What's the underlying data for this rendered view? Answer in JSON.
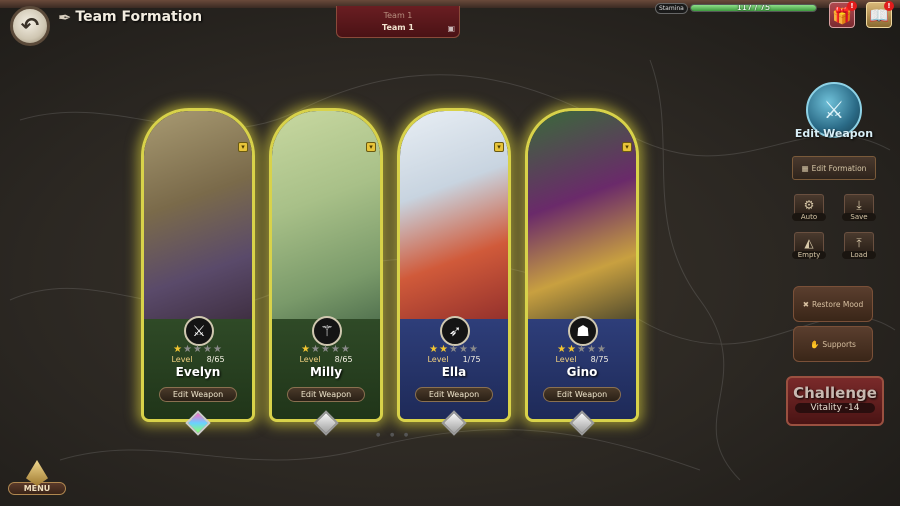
{
  "header": {
    "title": "Team Formation",
    "team_tab_top": "Team 1",
    "team_tab_bottom": "Team 1",
    "stamina_label": "Stamina",
    "stamina_value": "117 / 75",
    "stamina_fraction": 1.0
  },
  "cards": [
    {
      "name": "Evelyn",
      "level_label": "Level",
      "level": "8/65",
      "stars": 1,
      "max_stars": 5,
      "class_icon": "sword-icon",
      "edit_weapon_label": "Edit Weapon",
      "theme": "green",
      "gem": "rainbow"
    },
    {
      "name": "Milly",
      "level_label": "Level",
      "level": "8/65",
      "stars": 1,
      "max_stars": 5,
      "class_icon": "staff-icon",
      "edit_weapon_label": "Edit Weapon",
      "theme": "green",
      "gem": "silver"
    },
    {
      "name": "Ella",
      "level_label": "Level",
      "level": "1/75",
      "stars": 2,
      "max_stars": 5,
      "class_icon": "bow-icon",
      "edit_weapon_label": "Edit Weapon",
      "theme": "blue",
      "gem": "silver"
    },
    {
      "name": "Gino",
      "level_label": "Level",
      "level": "8/75",
      "stars": 2,
      "max_stars": 5,
      "class_icon": "book-icon",
      "edit_weapon_label": "Edit Weapon",
      "theme": "blue",
      "gem": "silver"
    }
  ],
  "sidebar": {
    "edit_weapon": "Edit Weapon",
    "edit_formation": "Edit Formation",
    "auto": "Auto",
    "save": "Save",
    "empty": "Empty",
    "load": "Load",
    "restore_mood": "Restore Mood",
    "supports": "Supports",
    "challenge": "Challenge",
    "vitality": "Vitality -14"
  },
  "menu": {
    "label": "MENU"
  },
  "colors": {
    "card_glow": "#d8d24a",
    "green_plate": "#2f4a27",
    "blue_plate": "#2e3e7a",
    "challenge": "#7a2a2a"
  }
}
